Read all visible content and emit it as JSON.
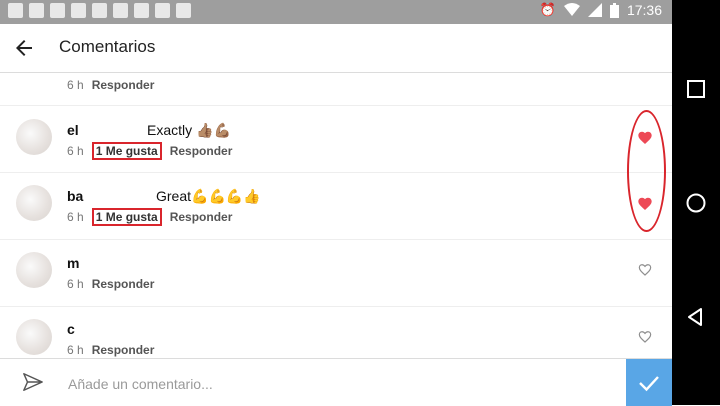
{
  "status_bar": {
    "time": "17:36",
    "left_icons": [
      "calendar-icon",
      "telegram-icon",
      "calendar-date-icon",
      "gmail-icon",
      "tumblr-icon",
      "chat-icon",
      "linkedin-icon",
      "gallery-icon",
      "flipboard-icon"
    ],
    "right_icons": [
      "alarm-icon",
      "wifi-icon",
      "cell-signal-icon",
      "battery-icon"
    ]
  },
  "header": {
    "title": "Comentarios"
  },
  "comments": [
    {
      "username": "",
      "text": "",
      "time": "6 h",
      "likes": "",
      "reply": "Responder",
      "liked": false,
      "show_heart": false
    },
    {
      "username": "el",
      "text": "Exactly 👍🏽💪🏽",
      "time": "6 h",
      "likes": "1 Me gusta",
      "reply": "Responder",
      "liked": true,
      "show_heart": true
    },
    {
      "username": "ba",
      "text": "Great💪💪💪👍",
      "time": "6 h",
      "likes": "1 Me gusta",
      "reply": "Responder",
      "liked": true,
      "show_heart": true
    },
    {
      "username": "m",
      "text": "",
      "time": "6 h",
      "likes": "",
      "reply": "Responder",
      "liked": false,
      "show_heart": true
    },
    {
      "username": "c",
      "text": "",
      "time": "6 h",
      "likes": "",
      "reply": "Responder",
      "liked": false,
      "show_heart": true
    }
  ],
  "composer": {
    "placeholder": "Añade un comentario...",
    "value": ""
  },
  "colors": {
    "accent": "#59a6e6",
    "like": "#ed4956",
    "annotation": "#d9252c"
  },
  "nav_bar": {
    "icons": [
      "recents-icon",
      "home-icon",
      "back-icon"
    ]
  }
}
